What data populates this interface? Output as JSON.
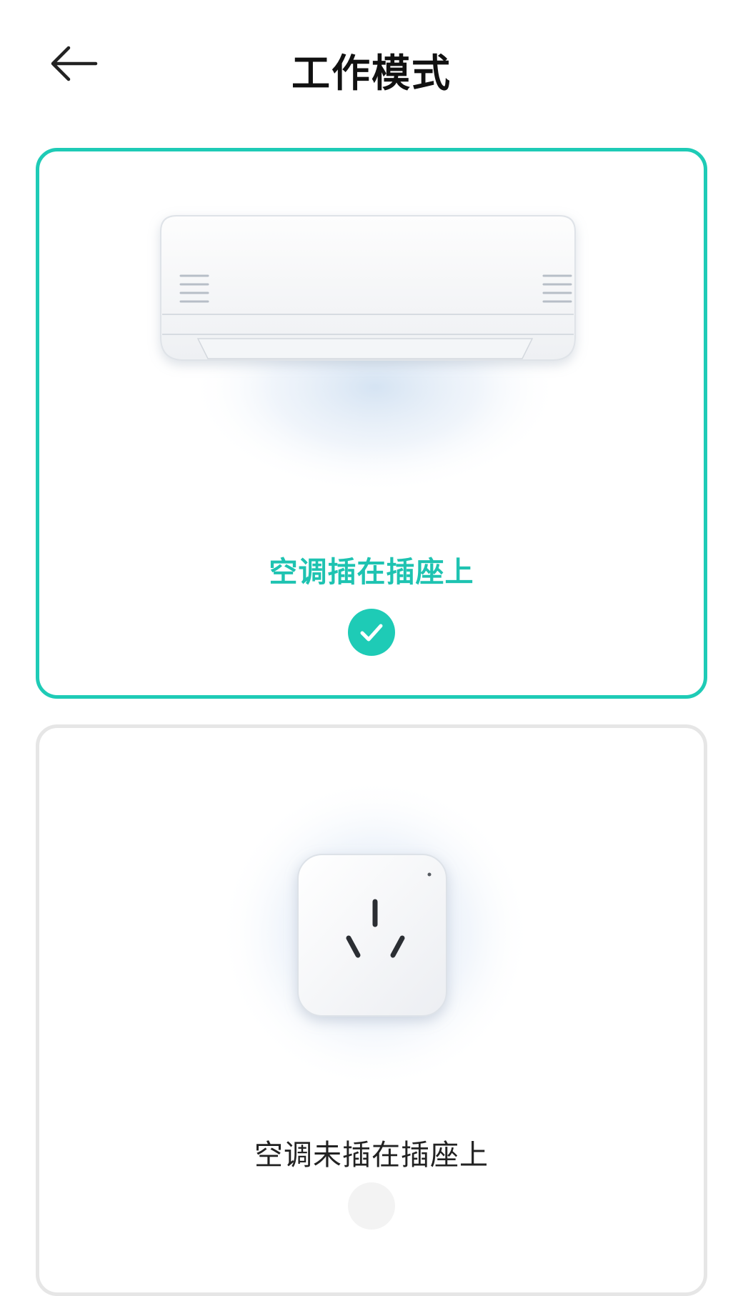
{
  "header": {
    "title": "工作模式",
    "back_icon": "arrow-left-icon"
  },
  "modes": [
    {
      "label": "空调插在插座上",
      "selected": true,
      "illustration": "air-conditioner-icon"
    },
    {
      "label": "空调未插在插座上",
      "selected": false,
      "illustration": "power-socket-icon"
    }
  ],
  "colors": {
    "accent": "#1ecbb6",
    "title_text": "#111111",
    "unselected_border": "#e6e6e6"
  }
}
